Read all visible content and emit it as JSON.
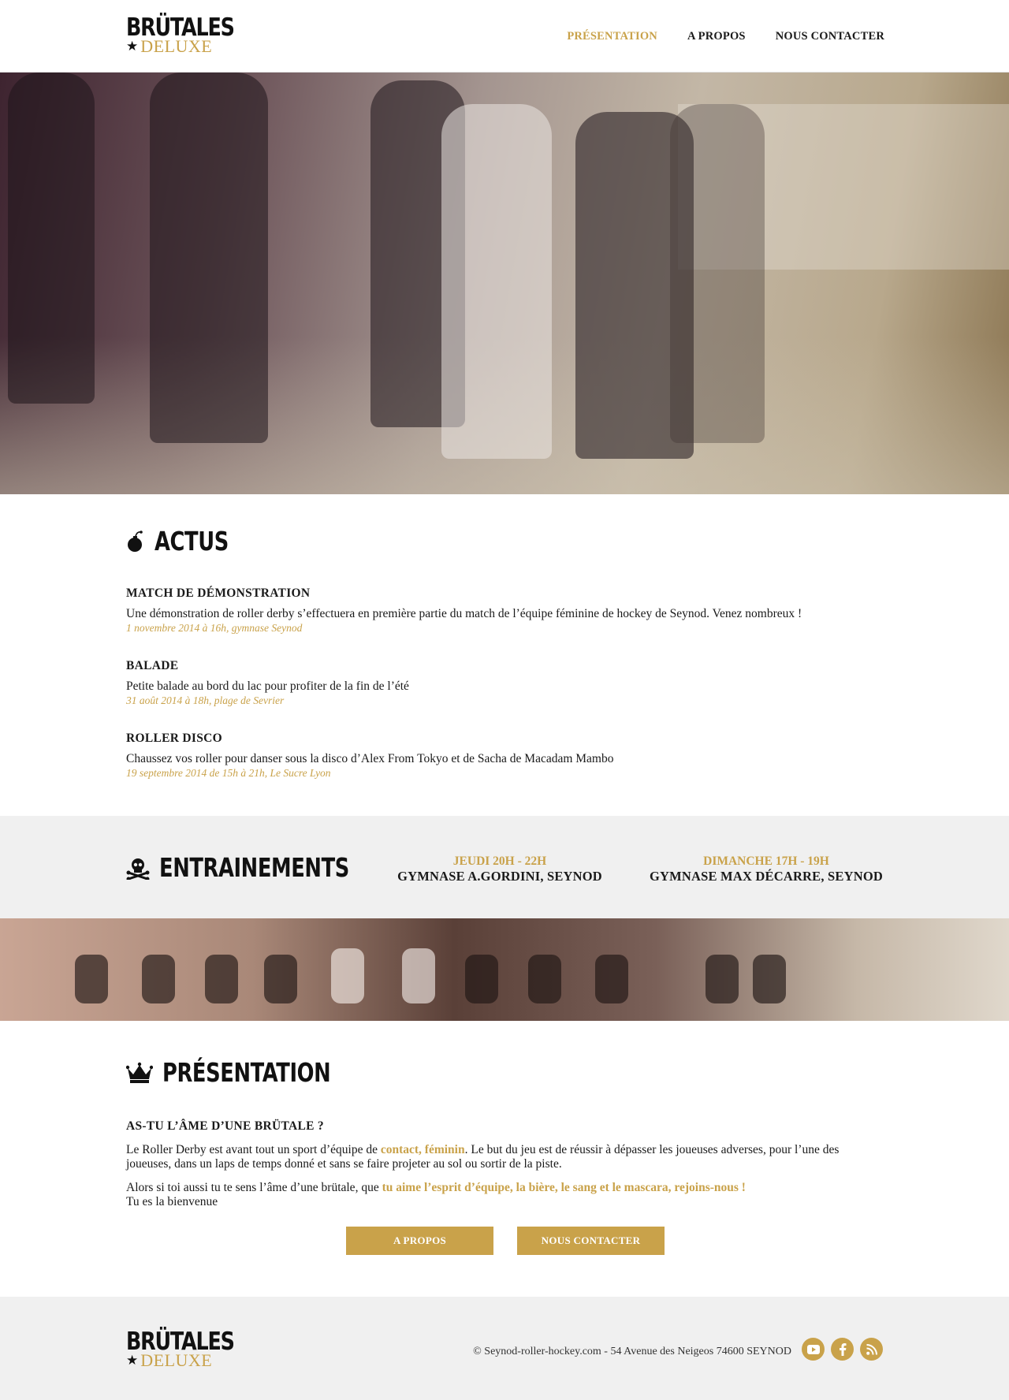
{
  "header": {
    "logo_top": "BRÜTALES",
    "logo_star": "★",
    "logo_bottom": "DELUXE",
    "nav": [
      "PRÉSENTATION",
      "A PROPOS",
      "NOUS CONTACTER"
    ],
    "active_nav": "PRÉSENTATION"
  },
  "actus": {
    "title": "ACTUS",
    "items": [
      {
        "title": "MATCH DE DÉMONSTRATION",
        "desc": "Une démonstration de roller derby s’effectuera en première partie du match de l’équipe féminine de hockey de Seynod. Venez nombreux !",
        "meta": "1 novembre 2014 à 16h, gymnase Seynod"
      },
      {
        "title": "BALADE",
        "desc": "Petite balade au bord du lac pour profiter de la fin de l’été",
        "meta": "31 août 2014 à 18h, plage de Sevrier"
      },
      {
        "title": "ROLLER DISCO",
        "desc": "Chaussez vos roller pour danser sous la disco d’Alex From Tokyo et de Sacha de Macadam Mambo",
        "meta": "19 septembre 2014 de 15h à 21h, Le Sucre Lyon"
      }
    ]
  },
  "training": {
    "title": "ENTRAINEMENTS",
    "slots": [
      {
        "when": "JEUDI 20H - 22H",
        "where": "GYMNASE A.GORDINI, SEYNOD"
      },
      {
        "when": "DIMANCHE 17H - 19H",
        "where": "GYMNASE MAX DÉCARRE, SEYNOD"
      }
    ]
  },
  "presentation": {
    "title": "PRÉSENTATION",
    "subtitle": "AS-TU L’ÂME D’UNE BRÜTALE ?",
    "p1_a": "Le Roller Derby est avant tout un sport d’équipe de ",
    "p1_b": "contact, féminin",
    "p1_c": ". Le but du jeu est de réussir à dépasser les joueuses adverses, pour l’une des joueuses, dans un laps de temps donné et sans se faire projeter au sol ou sortir de la piste.",
    "p2_a": "Alors si toi aussi tu te sens l’âme d’une brütale, que ",
    "p2_b": "tu aime l’esprit d’équipe, la bière, le sang et le mascara, rejoins-nous !",
    "p2_c": "Tu es la bienvenue",
    "btn_about": "A PROPOS",
    "btn_contact": "NOUS CONTACTER"
  },
  "footer": {
    "copyright": "© Seynod-roller-hockey.com - 54 Avenue des Neigeos 74600 SEYNOD",
    "social": [
      "youtube-icon",
      "facebook-icon",
      "rss-icon"
    ]
  },
  "colors": {
    "accent": "#c9a24a",
    "band_bg": "#f0f0f0"
  }
}
